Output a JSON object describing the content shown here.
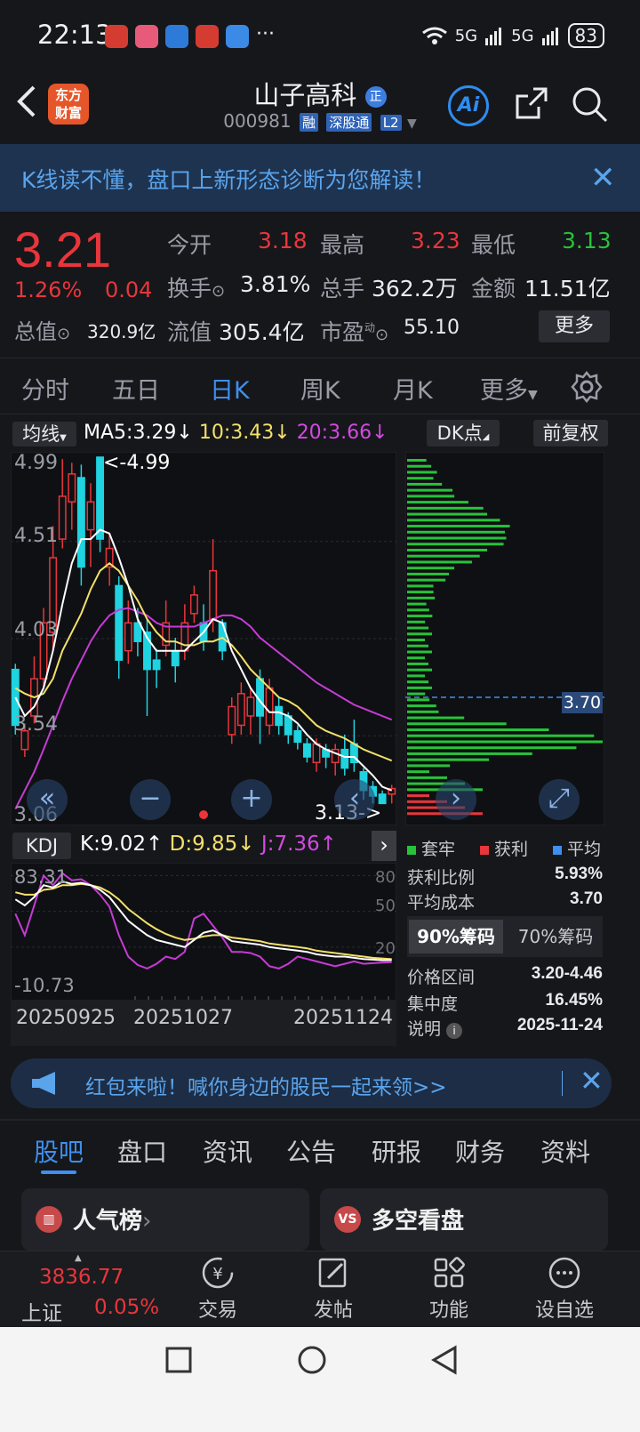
{
  "status_bar": {
    "time": "22:13",
    "more": "···",
    "net1": "5G",
    "net2": "5G",
    "battery": "83"
  },
  "header": {
    "back_icon": "back-arrow-icon",
    "brand_logo_line1": "东方",
    "brand_logo_line2": "财富",
    "stock_name": "山子高科",
    "name_badge": "正",
    "stock_code": "000981",
    "tags": [
      "融",
      "深股通",
      "L2"
    ],
    "ai_label": "Ai"
  },
  "banner": {
    "text": "K线读不懂，盘口上新形态诊断为您解读！",
    "close": "✕"
  },
  "quote": {
    "price": "3.21",
    "change_pct": "1.26%",
    "change_val": "0.04",
    "total_mv_label": "总值",
    "total_mv": "320.9亿",
    "open_label": "今开",
    "open": "3.18",
    "high_label": "最高",
    "high": "3.23",
    "low_label": "最低",
    "low": "3.13",
    "turnover_label": "换手",
    "turnover": "3.81%",
    "volume_label": "总手",
    "volume": "362.2万",
    "amount_label": "金额",
    "amount": "11.51亿",
    "float_mv_label": "流值",
    "float_mv": "305.4亿",
    "pe_label": "市盈",
    "pe_sup": "动",
    "pe": "55.10",
    "more_button": "更多"
  },
  "period_tabs": [
    {
      "label": "分时"
    },
    {
      "label": "五日"
    },
    {
      "label": "日K"
    },
    {
      "label": "周K"
    },
    {
      "label": "月K"
    },
    {
      "label": "更多"
    }
  ],
  "active_period": "日K",
  "kline": {
    "ma_select": "均线",
    "ma5": "MA5:3.29↓",
    "ma10": "10:3.43↓",
    "ma20": "20:3.66↓",
    "dk_button": "DK点",
    "adjust_button": "前复权",
    "y_labels": [
      "4.99",
      "4.51",
      "4.03",
      "3.54",
      "3.06"
    ],
    "high_marker": "<-4.99",
    "low_marker": "3.13->",
    "colors": {
      "up": "#e8363b",
      "down": "#1fd3e0",
      "ma5": "#ffffff",
      "ma10": "#f3e06a",
      "ma20": "#c63bd6"
    }
  },
  "chart_data": {
    "type": "candlestick",
    "ylim": [
      3.06,
      4.99
    ],
    "candles": [
      {
        "o": 3.85,
        "c": 3.55,
        "h": 3.88,
        "l": 3.5
      },
      {
        "o": 3.42,
        "c": 3.52,
        "h": 3.56,
        "l": 3.38
      },
      {
        "o": 3.6,
        "c": 3.8,
        "h": 3.92,
        "l": 3.56
      },
      {
        "o": 3.8,
        "c": 4.1,
        "h": 4.18,
        "l": 3.75
      },
      {
        "o": 4.05,
        "c": 4.45,
        "h": 4.62,
        "l": 3.95
      },
      {
        "o": 4.55,
        "c": 4.78,
        "h": 4.98,
        "l": 4.5
      },
      {
        "o": 4.75,
        "c": 4.9,
        "h": 4.96,
        "l": 4.6
      },
      {
        "o": 4.88,
        "c": 4.4,
        "h": 4.95,
        "l": 4.3
      },
      {
        "o": 4.6,
        "c": 4.75,
        "h": 4.85,
        "l": 4.4
      },
      {
        "o": 4.99,
        "c": 4.55,
        "h": 4.99,
        "l": 4.48
      },
      {
        "o": 4.4,
        "c": 4.5,
        "h": 4.58,
        "l": 4.3
      },
      {
        "o": 4.3,
        "c": 3.9,
        "h": 4.35,
        "l": 3.8
      },
      {
        "o": 3.95,
        "c": 4.1,
        "h": 4.22,
        "l": 3.88
      },
      {
        "o": 4.1,
        "c": 4.0,
        "h": 4.18,
        "l": 3.92
      },
      {
        "o": 4.05,
        "c": 3.85,
        "h": 4.12,
        "l": 3.6
      },
      {
        "o": 3.9,
        "c": 3.85,
        "h": 3.96,
        "l": 3.75
      },
      {
        "o": 3.98,
        "c": 4.1,
        "h": 4.22,
        "l": 3.92
      },
      {
        "o": 3.95,
        "c": 3.87,
        "h": 4.02,
        "l": 3.78
      },
      {
        "o": 3.95,
        "c": 4.1,
        "h": 4.2,
        "l": 3.9
      },
      {
        "o": 4.15,
        "c": 4.25,
        "h": 4.3,
        "l": 4.1
      },
      {
        "o": 4.1,
        "c": 4.0,
        "h": 4.2,
        "l": 3.95
      },
      {
        "o": 4.12,
        "c": 4.38,
        "h": 4.55,
        "l": 4.05
      },
      {
        "o": 4.1,
        "c": 3.95,
        "h": 4.12,
        "l": 3.9
      },
      {
        "o": 3.5,
        "c": 3.65,
        "h": 3.7,
        "l": 3.45
      },
      {
        "o": 3.55,
        "c": 3.72,
        "h": 3.78,
        "l": 3.5
      },
      {
        "o": 3.6,
        "c": 3.7,
        "h": 3.75,
        "l": 3.5
      },
      {
        "o": 3.8,
        "c": 3.6,
        "h": 3.85,
        "l": 3.45
      },
      {
        "o": 3.55,
        "c": 3.75,
        "h": 3.8,
        "l": 3.5
      },
      {
        "o": 3.65,
        "c": 3.55,
        "h": 3.7,
        "l": 3.5
      },
      {
        "o": 3.6,
        "c": 3.5,
        "h": 3.62,
        "l": 3.45
      },
      {
        "o": 3.52,
        "c": 3.46,
        "h": 3.55,
        "l": 3.42
      },
      {
        "o": 3.45,
        "c": 3.38,
        "h": 3.48,
        "l": 3.35
      },
      {
        "o": 3.35,
        "c": 3.45,
        "h": 3.48,
        "l": 3.3
      },
      {
        "o": 3.42,
        "c": 3.38,
        "h": 3.45,
        "l": 3.32
      },
      {
        "o": 3.35,
        "c": 3.42,
        "h": 3.45,
        "l": 3.28
      },
      {
        "o": 3.42,
        "c": 3.32,
        "h": 3.5,
        "l": 3.28
      },
      {
        "o": 3.45,
        "c": 3.35,
        "h": 3.58,
        "l": 3.3
      },
      {
        "o": 3.3,
        "c": 3.2,
        "h": 3.32,
        "l": 3.15
      },
      {
        "o": 3.22,
        "c": 3.17,
        "h": 3.25,
        "l": 3.13
      },
      {
        "o": 3.18,
        "c": 3.13,
        "h": 3.2,
        "l": 3.13
      },
      {
        "o": 3.18,
        "c": 3.21,
        "h": 3.23,
        "l": 3.13
      }
    ],
    "ma5": [
      3.7,
      3.6,
      3.65,
      3.75,
      3.95,
      4.2,
      4.42,
      4.55,
      4.55,
      4.6,
      4.58,
      4.45,
      4.3,
      4.12,
      4.02,
      3.95,
      3.95,
      3.95,
      3.95,
      4.0,
      4.05,
      4.12,
      4.1,
      3.95,
      3.85,
      3.75,
      3.68,
      3.62,
      3.62,
      3.6,
      3.56,
      3.5,
      3.45,
      3.42,
      3.4,
      3.38,
      3.38,
      3.33,
      3.28,
      3.22,
      3.2
    ],
    "ma10": [
      3.75,
      3.72,
      3.7,
      3.72,
      3.8,
      3.95,
      4.05,
      4.15,
      4.28,
      4.38,
      4.42,
      4.38,
      4.3,
      4.22,
      4.12,
      4.05,
      4.0,
      4.0,
      3.98,
      3.98,
      4.0,
      4.0,
      4.02,
      3.98,
      3.92,
      3.85,
      3.8,
      3.75,
      3.7,
      3.68,
      3.65,
      3.6,
      3.55,
      3.52,
      3.5,
      3.48,
      3.45,
      3.42,
      3.4,
      3.38,
      3.36
    ],
    "ma20": [
      3.1,
      3.2,
      3.3,
      3.42,
      3.55,
      3.68,
      3.8,
      3.9,
      4.0,
      4.08,
      4.14,
      4.17,
      4.18,
      4.16,
      4.14,
      4.1,
      4.08,
      4.08,
      4.08,
      4.08,
      4.1,
      4.12,
      4.14,
      4.14,
      4.12,
      4.08,
      4.02,
      3.98,
      3.94,
      3.9,
      3.86,
      3.82,
      3.78,
      3.75,
      3.72,
      3.69,
      3.66,
      3.64,
      3.62,
      3.6,
      3.58
    ],
    "kdj": {
      "ylim": [
        -10.73,
        83.31
      ],
      "k": [
        60,
        55,
        62,
        72,
        70,
        75,
        73,
        74,
        72,
        68,
        62,
        52,
        42,
        36,
        30,
        26,
        24,
        22,
        20,
        26,
        32,
        34,
        30,
        25,
        24,
        23,
        22,
        20,
        19,
        18,
        17,
        16,
        14,
        13,
        12,
        12,
        11,
        10,
        9.5,
        9,
        9.02
      ],
      "d": [
        66,
        64,
        64,
        68,
        69,
        72,
        72,
        73,
        72,
        70,
        66,
        60,
        52,
        46,
        40,
        35,
        31,
        28,
        26,
        27,
        29,
        30,
        30,
        28,
        27,
        26,
        25,
        23,
        22,
        21,
        20,
        19,
        17,
        16,
        15,
        14,
        13,
        12,
        11,
        10.5,
        9.85
      ],
      "j": [
        48,
        30,
        55,
        80,
        72,
        82,
        76,
        77,
        72,
        64,
        54,
        30,
        12,
        5,
        2,
        6,
        12,
        10,
        16,
        44,
        48,
        38,
        28,
        16,
        16,
        15,
        12,
        4,
        2,
        6,
        12,
        10,
        8,
        6,
        4,
        6,
        8,
        6,
        6.5,
        7,
        7.36
      ]
    },
    "chips": {
      "price_levels": 60,
      "profit_ratio": 5.93,
      "avg_cost": 3.7
    }
  },
  "kdj_panel": {
    "select": "KDJ",
    "k": "K:9.02↑",
    "d": "D:9.85↓",
    "j": "J:7.36↑",
    "arrow": "›",
    "y_top": "83.31",
    "y_bottom": "-10.73",
    "grid_labels": [
      "80",
      "50",
      "20"
    ],
    "dates": [
      "20250925",
      "20251027",
      "20251124"
    ]
  },
  "chip_panel": {
    "avg_marker": "3.70",
    "legend": [
      {
        "label": "套牢",
        "color": "#28c23a"
      },
      {
        "label": "获利",
        "color": "#e8363b"
      },
      {
        "label": "平均",
        "color": "#3e8ff0"
      }
    ],
    "profit_ratio_label": "获利比例",
    "profit_ratio": "5.93%",
    "avg_cost_label": "平均成本",
    "avg_cost": "3.70",
    "tab_90": "90%筹码",
    "tab_70": "70%筹码",
    "range_label": "价格区间",
    "range": "3.20-4.46",
    "concentration_label": "集中度",
    "concentration": "16.45%",
    "note_label": "说明",
    "note_date": "2025-11-24"
  },
  "promo": {
    "text": "红包来啦！喊你身边的股民一起来领>>",
    "close": "✕"
  },
  "content_tabs": [
    {
      "label": "股吧"
    },
    {
      "label": "盘口"
    },
    {
      "label": "资讯"
    },
    {
      "label": "公告"
    },
    {
      "label": "研报"
    },
    {
      "label": "财务"
    },
    {
      "label": "资料"
    }
  ],
  "cards": {
    "popularity": "人气榜",
    "popularity_arrow": "›",
    "longshort": "多空看盘",
    "vs": "VS"
  },
  "bottom_nav": {
    "index_value": "3836.77",
    "index_name": "上证",
    "index_pct": "0.05%",
    "items": [
      {
        "label": "交易",
        "icon": "yuan-trade-icon"
      },
      {
        "label": "发帖",
        "icon": "edit-post-icon"
      },
      {
        "label": "功能",
        "icon": "grid-apps-icon"
      },
      {
        "label": "设自选",
        "icon": "more-dots-icon"
      }
    ]
  }
}
